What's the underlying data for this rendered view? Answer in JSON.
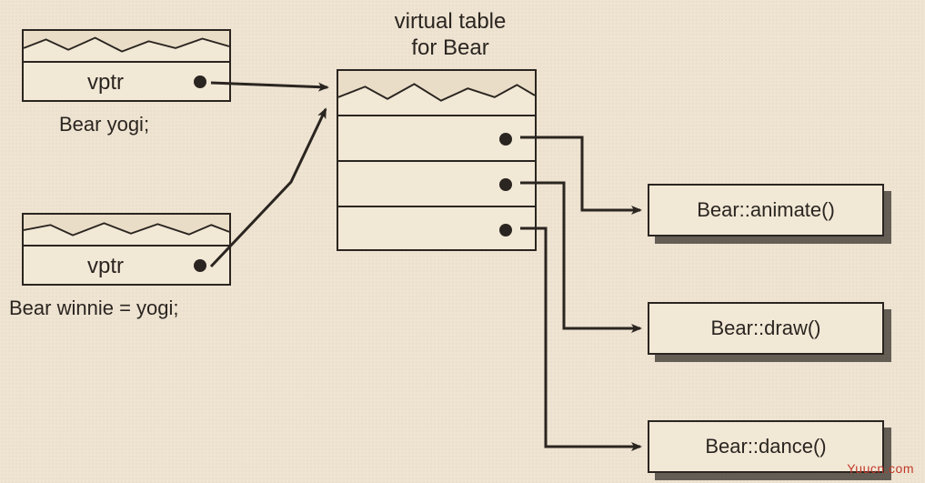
{
  "object1": {
    "vptr_label": "vptr",
    "caption": "Bear yogi;"
  },
  "object2": {
    "vptr_label": "vptr",
    "caption": "Bear winnie = yogi;"
  },
  "vtable": {
    "title_line1": "virtual table",
    "title_line2": "for Bear"
  },
  "functions": {
    "f1": "Bear::animate()",
    "f2": "Bear::draw()",
    "f3": "Bear::dance()"
  },
  "watermark": "Yuucn.com"
}
